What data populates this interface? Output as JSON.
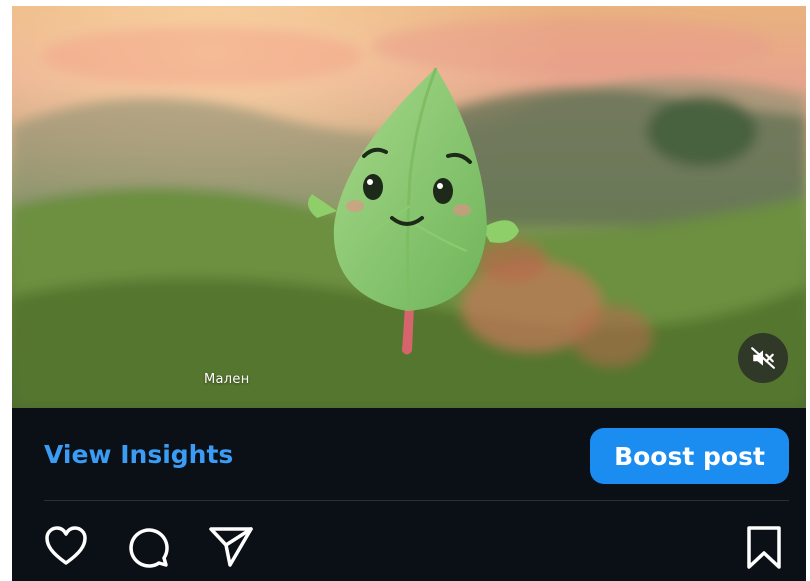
{
  "post": {
    "media": {
      "caption_text": "Мален",
      "icons": {
        "mute": "speaker-muted-icon"
      }
    },
    "insights": {
      "view_insights_label": "View Insights",
      "boost_post_label": "Boost post"
    },
    "actions": {
      "icons": [
        "heart-icon",
        "comment-icon",
        "share-icon",
        "bookmark-icon"
      ]
    }
  },
  "colors": {
    "background": "#0b0f16",
    "link_blue": "#3b9cf5",
    "boost_blue": "#1b8cf0",
    "icon_white": "#ffffff"
  }
}
